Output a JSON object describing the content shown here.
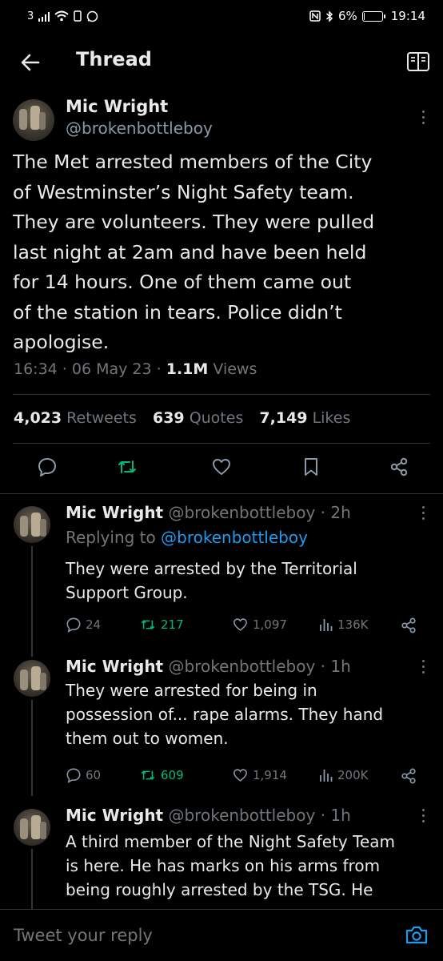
{
  "status_bar": {
    "sim": "3",
    "battery": "6%",
    "battery_fraction": 0.06,
    "time": "19:14"
  },
  "header": {
    "title": "Thread",
    "icons": [
      "back-arrow-icon",
      "reader-mode-icon"
    ]
  },
  "main_tweet": {
    "name": "Mic Wright",
    "handle": "@brokenbottleboy",
    "text_lines": [
      "The Met arrested members of the City",
      "of Westminster’s Night Safety team.",
      "They are volunteers. They were pulled",
      "last night at 2am and have been held",
      "for 14 hours. One of them came out",
      "of the station in tears. Police didn’t",
      "apologise."
    ],
    "time": "16:34",
    "date": "06 May 23",
    "views_count": "1.1M",
    "views_label": "Views",
    "retweets_count": "4,023",
    "retweets_label": "Retweets",
    "quotes_count": "639",
    "quotes_label": "Quotes",
    "likes_count": "7,149",
    "likes_label": "Likes"
  },
  "replies": [
    {
      "name": "Mic Wright",
      "handle": "@brokenbottleboy",
      "age": "2h",
      "replying_prefix": "Replying to",
      "replying_to": "@brokenbottleboy",
      "text_lines": [
        "They were arrested by the Territorial",
        "Support Group."
      ],
      "replies": "24",
      "retweets": "217",
      "likes": "1,097",
      "views": "136K"
    },
    {
      "name": "Mic Wright",
      "handle": "@brokenbottleboy",
      "age": "1h",
      "text_lines": [
        "They were arrested for being in",
        "possession of... rape alarms. They hand",
        "them out to women."
      ],
      "replies": "60",
      "retweets": "609",
      "likes": "1,914",
      "views": "200K"
    },
    {
      "name": "Mic Wright",
      "handle": "@brokenbottleboy",
      "age": "1h",
      "text_lines": [
        "A third member of the Night Safety Team",
        "is here. He has marks on his arms from",
        "being roughly arrested by the TSG. He"
      ]
    }
  ],
  "reply_bar": {
    "placeholder": "Tweet your reply"
  },
  "colors": {
    "background": "#000000",
    "text": "#e7e9ea",
    "secondary": "#71767b",
    "link": "#1d9bf0",
    "retweet_green": "#00ba7c"
  }
}
